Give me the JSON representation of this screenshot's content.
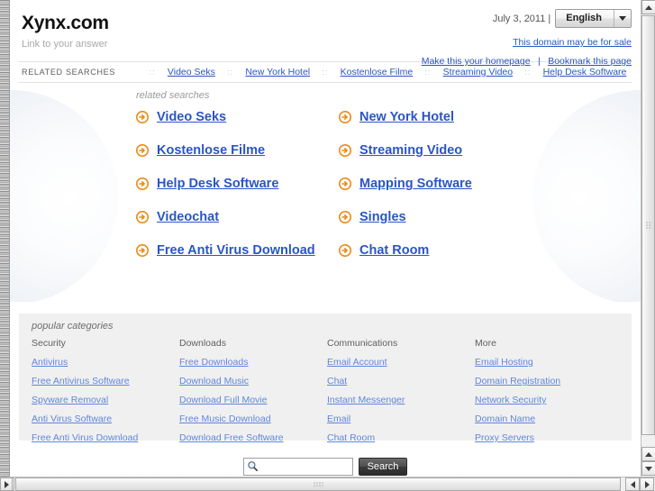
{
  "header": {
    "logo_title": "Xynx.com",
    "logo_tagline": "Link to your answer",
    "date": "July 3, 2011 |",
    "language_selected": "English",
    "language_caret_icon": "chevron-down-icon",
    "domain_for_sale": "This domain may be for sale",
    "make_homepage": "Make this your homepage",
    "link_separator": "|",
    "bookmark_page": "Bookmark this page"
  },
  "navbar": {
    "caption": "RELATED SEARCHES",
    "separator": "::",
    "links": [
      "Video Seks",
      "New York Hotel",
      "Kostenlose Filme",
      "Streaming Video",
      "Help Desk Software"
    ]
  },
  "hero": {
    "caption": "related searches",
    "arrow_icon": "arrow-circle-right-icon",
    "links": [
      "Video Seks",
      "New York Hotel",
      "Kostenlose Filme",
      "Streaming Video",
      "Help Desk Software",
      "Mapping Software",
      "Videochat",
      "Singles",
      "Free Anti Virus Download",
      "Chat Room"
    ]
  },
  "categories": {
    "caption": "popular categories",
    "columns": [
      {
        "title": "Security",
        "links": [
          "Antivirus",
          "Free Antivirus Software",
          "Spyware Removal",
          "Anti Virus Software",
          "Free Anti Virus Download"
        ]
      },
      {
        "title": "Downloads",
        "links": [
          "Free Downloads",
          "Download Music",
          "Download Full Movie",
          "Free Music Download",
          "Download Free Software"
        ]
      },
      {
        "title": "Communications",
        "links": [
          "Email Account",
          "Chat",
          "Instant Messenger",
          "Email",
          "Chat Room"
        ]
      },
      {
        "title": "More",
        "links": [
          "Email Hosting",
          "Domain Registration",
          "Network Security",
          "Domain Name",
          "Proxy Servers"
        ]
      }
    ]
  },
  "search": {
    "icon": "magnifier-icon",
    "value": "",
    "placeholder": "",
    "button_label": "Search"
  },
  "colors": {
    "link_blue": "#2b55c4",
    "category_link_blue": "#5f86dd",
    "arrow_orange": "#e98a16",
    "panel_gray": "#f0f0f0",
    "tagline_gray": "#a8a8a8"
  }
}
